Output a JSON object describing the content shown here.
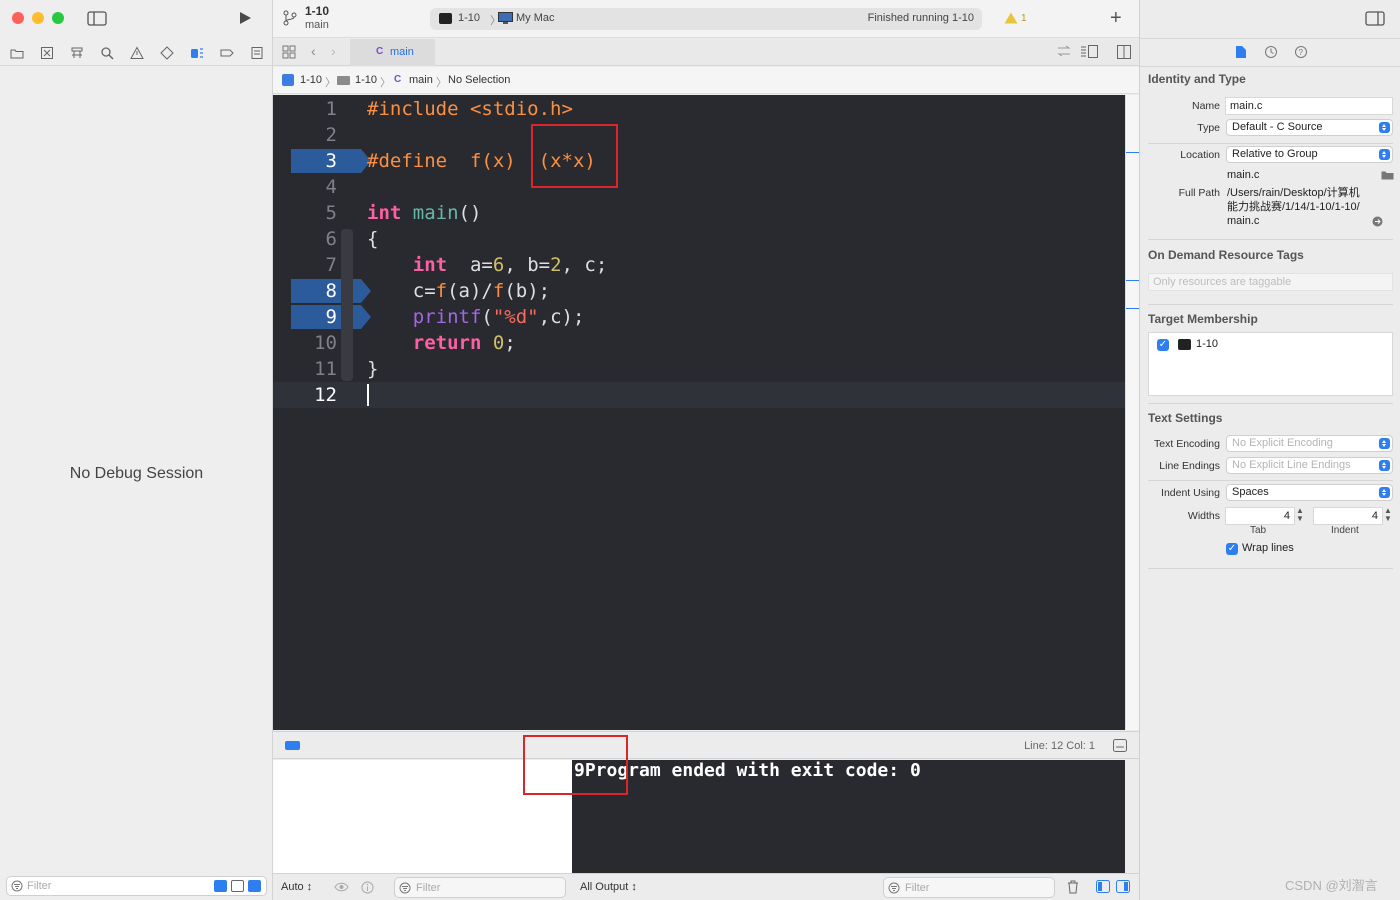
{
  "toolbar": {
    "scheme_name": "1-10",
    "scheme_branch": "main",
    "activity_target": "1-10",
    "activity_destination": "My Mac",
    "activity_status": "Finished running 1-10",
    "warning_count": "1"
  },
  "tabs": [
    {
      "label": "main",
      "icon": "C"
    }
  ],
  "jumpbar": {
    "items": [
      "1-10",
      "1-10",
      "main",
      "No Selection"
    ],
    "file_icon": "C"
  },
  "editor": {
    "line_numbers": [
      "1",
      "2",
      "3",
      "4",
      "5",
      "6",
      "7",
      "8",
      "9",
      "10",
      "11",
      "12"
    ],
    "breakpoint_lines": [
      "3",
      "8",
      "9"
    ],
    "current_line": "12",
    "lines": {
      "l1_directive": "#include",
      "l1_header": "<stdio.h>",
      "l3_directive": "#define",
      "l3_macro": "f(x)",
      "l3_body": "(x*x)",
      "l5_type": "int",
      "l5_func": "main",
      "l5_parens": "()",
      "l6": "{",
      "l7_type": "int",
      "l7_a": "a=",
      "l7_a_val": "6",
      "l7_sep": ", b=",
      "l7_b_val": "2",
      "l7_rest": ", c;",
      "l8_c": "c=",
      "l8_f1": "f",
      "l8_mid": "(a)/",
      "l8_f2": "f",
      "l8_end": "(b);",
      "l9_func": "printf",
      "l9_open": "(",
      "l9_str": "\"%d\"",
      "l9_rest": ",c);",
      "l10_kw": "return",
      "l10_val": "0",
      "l10_end": ";",
      "l11": "}"
    }
  },
  "debug": {
    "no_session": "No Debug Session",
    "line_col": "Line: 12  Col: 1"
  },
  "console": {
    "output": "9Program ended with exit code: 0",
    "output_selector": "All Output ↕",
    "auto_selector": "Auto ↕"
  },
  "filters": {
    "left": "Filter",
    "variables": "Filter",
    "console": "Filter"
  },
  "inspector": {
    "identity_title": "Identity and Type",
    "name_label": "Name",
    "name_value": "main.c",
    "type_label": "Type",
    "type_value": "Default - C Source",
    "location_label": "Location",
    "location_value": "Relative to Group",
    "location_file": "main.c",
    "full_path_label": "Full Path",
    "full_path_l1": "/Users/rain/Desktop/计算机",
    "full_path_l2": "能力挑战赛/1/14/1-10/1-10/",
    "full_path_l3": "main.c",
    "on_demand_title": "On Demand Resource Tags",
    "on_demand_placeholder": "Only resources are taggable",
    "target_title": "Target Membership",
    "target_item": "1-10",
    "text_settings_title": "Text Settings",
    "encoding_label": "Text Encoding",
    "encoding_value": "No Explicit Encoding",
    "line_endings_label": "Line Endings",
    "line_endings_value": "No Explicit Line Endings",
    "indent_using_label": "Indent Using",
    "indent_using_value": "Spaces",
    "widths_label": "Widths",
    "tab_width": "4",
    "indent_width": "4",
    "tab_caption": "Tab",
    "indent_caption": "Indent",
    "wrap_lines_label": "Wrap lines"
  },
  "watermark": "CSDN @刘潪言",
  "colors": {
    "editor_bg": "#292a30",
    "breakpoint": "#2b5b9a",
    "preprocessor": "#fd8f3f",
    "keyword": "#fc5fa3",
    "accent": "#2e7ef0",
    "annotation_red": "#d9262a"
  }
}
